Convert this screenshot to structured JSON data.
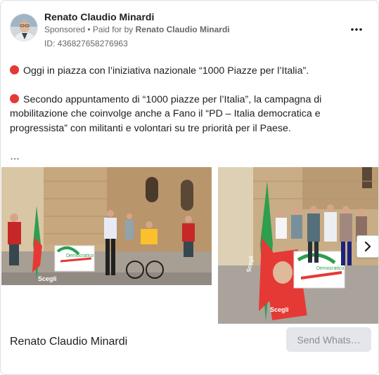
{
  "author": {
    "name": "Renato Claudio Minardi",
    "sponsored": "Sponsored",
    "separator": " • ",
    "paid_for_prefix": "Paid for by ",
    "paid_for_name": "Renato Claudio Minardi",
    "ad_id": "ID: 436827658276963"
  },
  "post": {
    "line1": "Oggi in piazza con l’iniziativa nazionale “1000 Piazze per l’Italia”.",
    "line2": "Secondo appuntamento di “1000 piazze per l’Italia”, la campagna di mobilitazione che coinvolge anche a Fano il “PD – Italia democratica e progressista” con militanti e volontari su tre priorità per il Paese.",
    "ellipsis": "…"
  },
  "photos": {
    "banner_text_1": "Scegli",
    "banner_text_2": "Democratico",
    "banner_text_3": "Scegli",
    "banner_text_4": "Democratico",
    "banner_text_5": "Scegli"
  },
  "footer": {
    "page_name": "Renato Claudio Minardi",
    "button_label": "Send Whats…"
  },
  "colors": {
    "pd_red": "#e53935",
    "pd_green": "#2e9e4f",
    "stone": "#c9ad86",
    "text_secondary": "#65676b"
  },
  "icons": {
    "more": "more-horizontal-icon",
    "next": "chevron-right-icon",
    "bullet": "red-circle-icon"
  }
}
